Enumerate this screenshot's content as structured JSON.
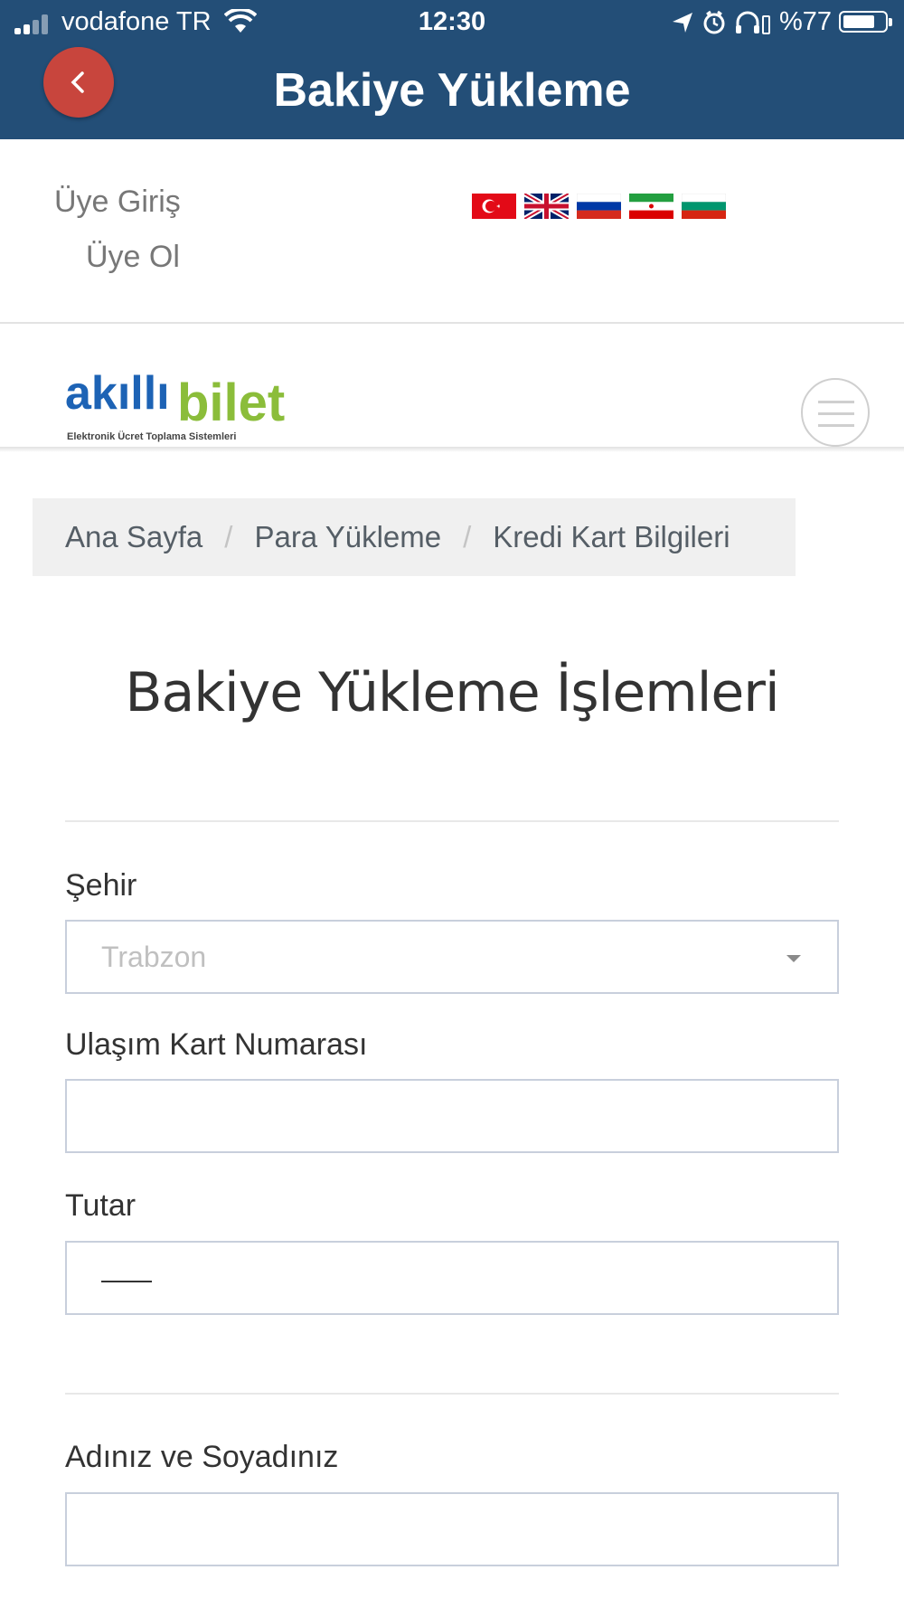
{
  "status_bar": {
    "carrier": "vodafone TR",
    "time": "12:30",
    "battery": "%77"
  },
  "header": {
    "title": "Bakiye Yükleme",
    "back_icon": "chevron-left-icon",
    "color": "#234e77",
    "back_color": "#c8453d"
  },
  "member": {
    "login": "Üye Giriş",
    "register": "Üye Ol"
  },
  "flags": [
    "turkey-flag-icon",
    "uk-flag-icon",
    "russia-flag-icon",
    "iran-flag-icon",
    "bulgaria-flag-icon"
  ],
  "logo": {
    "part1": "akıllı",
    "part2": "bilet",
    "tagline": "Elektronik Ücret Toplama Sistemleri"
  },
  "breadcrumb": {
    "items": [
      "Ana Sayfa",
      "Para Yükleme",
      "Kredi Kart Bilgileri"
    ],
    "separator": "/"
  },
  "page_title": "Bakiye Yükleme İşlemleri",
  "form": {
    "city_label": "Şehir",
    "city_value": "Trabzon",
    "card_label": "Ulaşım Kart Numarası",
    "card_value": "",
    "amount_label": "Tutar",
    "amount_value": "",
    "name_label": "Adınız ve Soyadınız",
    "name_value": ""
  }
}
